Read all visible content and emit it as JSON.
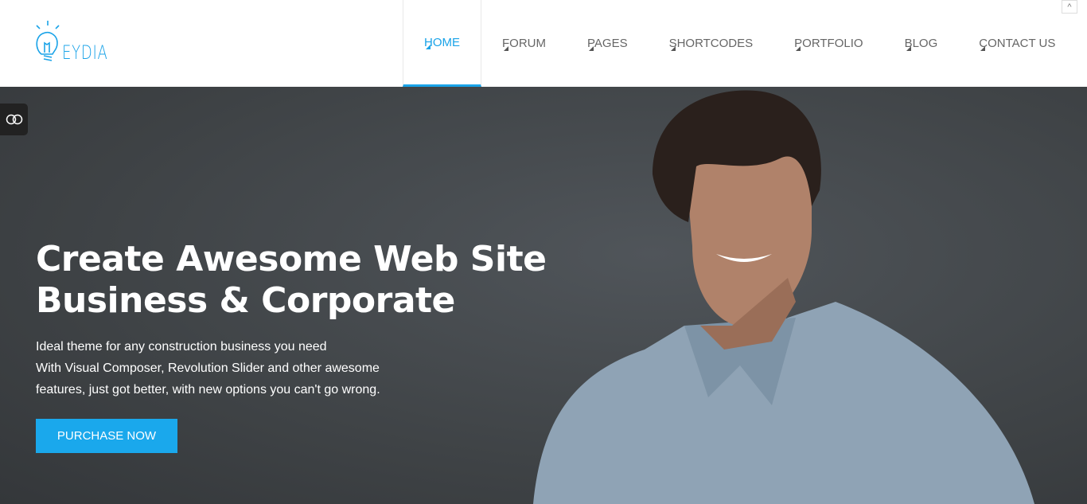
{
  "logo": {
    "text": "EYDIA",
    "color": "#1aa3e8"
  },
  "nav": {
    "items": [
      {
        "label": "HOME",
        "active": true
      },
      {
        "label": "FORUM"
      },
      {
        "label": "PAGES"
      },
      {
        "label": "SHORTCODES"
      },
      {
        "label": "PORTFOLIO"
      },
      {
        "label": "BLOG"
      },
      {
        "label": "CONTACT US"
      }
    ],
    "scroll_top": "^"
  },
  "hero": {
    "title_line1": "Create Awesome Web Site",
    "title_line2": "Business & Corporate",
    "desc_line1": "Ideal theme for any construction business you need",
    "desc_line2": "With Visual Composer, Revolution Slider and other awesome",
    "desc_line3": "features, just got better, with new options you can't go wrong.",
    "button": "PURCHASE NOW"
  },
  "colors": {
    "accent": "#1aa8ec",
    "hero_bg": "#43474a"
  }
}
